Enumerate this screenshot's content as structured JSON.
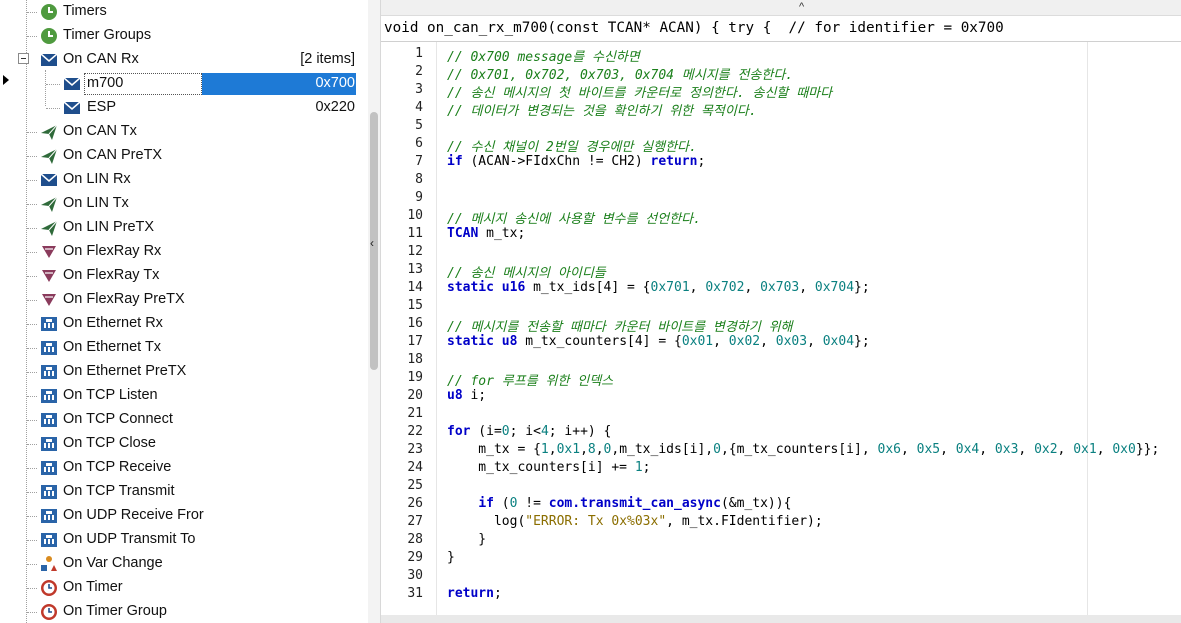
{
  "tree": {
    "items": [
      {
        "label": "Timers",
        "icon": "clock-icon"
      },
      {
        "label": "Timer Groups",
        "icon": "clock-icon"
      },
      {
        "label": "On CAN Rx",
        "icon": "envelope-icon",
        "count": "[2 items]"
      },
      {
        "label": "m700",
        "icon": "envelope-icon",
        "id": "0x700"
      },
      {
        "label": "ESP",
        "icon": "envelope-icon",
        "id": "0x220"
      },
      {
        "label": "On CAN Tx",
        "icon": "paper-plane-icon"
      },
      {
        "label": "On CAN PreTX",
        "icon": "paper-plane-icon"
      },
      {
        "label": "On LIN Rx",
        "icon": "envelope-icon"
      },
      {
        "label": "On LIN Tx",
        "icon": "paper-plane-icon"
      },
      {
        "label": "On LIN PreTX",
        "icon": "paper-plane-icon"
      },
      {
        "label": "On FlexRay Rx",
        "icon": "flexray-icon"
      },
      {
        "label": "On FlexRay Tx",
        "icon": "flexray-icon"
      },
      {
        "label": "On FlexRay PreTX",
        "icon": "flexray-icon"
      },
      {
        "label": "On Ethernet Rx",
        "icon": "ethernet-icon"
      },
      {
        "label": "On Ethernet Tx",
        "icon": "ethernet-icon"
      },
      {
        "label": "On Ethernet PreTX",
        "icon": "ethernet-icon"
      },
      {
        "label": "On TCP Listen",
        "icon": "ethernet-icon"
      },
      {
        "label": "On TCP Connect",
        "icon": "ethernet-icon"
      },
      {
        "label": "On TCP Close",
        "icon": "ethernet-icon"
      },
      {
        "label": "On TCP Receive",
        "icon": "ethernet-icon"
      },
      {
        "label": "On TCP Transmit",
        "icon": "ethernet-icon"
      },
      {
        "label": "On UDP Receive Fror",
        "icon": "ethernet-icon"
      },
      {
        "label": "On UDP Transmit To",
        "icon": "ethernet-icon"
      },
      {
        "label": "On Var Change",
        "icon": "variable-icon"
      },
      {
        "label": "On Timer",
        "icon": "clock-icon"
      },
      {
        "label": "On Timer Group",
        "icon": "clock-icon"
      }
    ],
    "collapse_glyph": "‹",
    "top_caret": "^"
  },
  "editor": {
    "signature": "void on_can_rx_m700(const TCAN* ACAN) { try {  // for identifier = 0x700",
    "lines": [
      "1",
      "2",
      "3",
      "4",
      "5",
      "6",
      "7",
      "8",
      "9",
      "10",
      "11",
      "12",
      "13",
      "14",
      "15",
      "16",
      "17",
      "18",
      "19",
      "20",
      "21",
      "22",
      "23",
      "24",
      "25",
      "26",
      "27",
      "28",
      "29",
      "30",
      "31"
    ],
    "code": {
      "c1": "// 0x700 message를 수신하면",
      "c2": "// 0x701, 0x702, 0x703, 0x704 메시지를 전송한다.",
      "c3": "// 송신 메시지의 첫 바이트를 카운터로 정의한다. 송신할 때마다",
      "c4": "// 데이터가 변경되는 것을 확인하기 위한 목적이다.",
      "c6": "// 수신 채널이 2번일 경우에만 실행한다.",
      "c10": "// 메시지 송신에 사용할 변수를 선언한다.",
      "c13": "// 송신 메시지의 아이디들",
      "c16": "// 메시지를 전송할 때마다 카운터 바이트를 변경하기 위해",
      "c19": "// for 루프를 위한 인덱스",
      "kw_if": "if",
      "l7_mid": " (ACAN->FIdxChn != CH2) ",
      "kw_return": "return",
      "semi": ";",
      "kw_tcan": "TCAN",
      "l11_rest": " m_tx;",
      "kw_static": "static",
      "kw_u16": "u16",
      "l14_a": " m_tx_ids[4] = {",
      "n_701": "0x701",
      "n_702": "0x702",
      "n_703": "0x703",
      "n_704": "0x704",
      "comma": ", ",
      "l14_end": "};",
      "kw_u8": "u8",
      "l17_a": " m_tx_counters[4] = {",
      "n_01": "0x01",
      "n_02": "0x02",
      "n_03": "0x03",
      "n_04": "0x04",
      "l20_rest": " i;",
      "kw_for": "for",
      "l22_a": " (i=",
      "n_0": "0",
      "l22_b": "; i<",
      "n_4": "4",
      "l22_c": "; i++) {",
      "l23_a": "    m_tx = {",
      "n_1": "1",
      "comma_tight": ",",
      "n_0x1": "0x1",
      "n_8": "8",
      "l23_b": ",m_tx_ids[i],",
      "l23_c": ",{m_tx_counters[i], ",
      "n_06": "0x6",
      "n_05": "0x5",
      "n_04b": "0x4",
      "n_03b": "0x3",
      "n_02b": "0x2",
      "n_01b": "0x1",
      "n_00": "0x0",
      "l23_end": "}};",
      "l24_a": "    m_tx_counters[i] += ",
      "l24_end": ";",
      "l26_indent": "    ",
      "l26_a": " (",
      "l26_b": " != ",
      "fn_com": "com.transmit_can_async",
      "l26_c": "(&m_tx)){",
      "l27_a": "      log(",
      "s_err": "\"ERROR: Tx 0x%03x\"",
      "l27_b": ", m_tx.FIdentifier);",
      "l28": "    }",
      "l29": "}"
    }
  }
}
